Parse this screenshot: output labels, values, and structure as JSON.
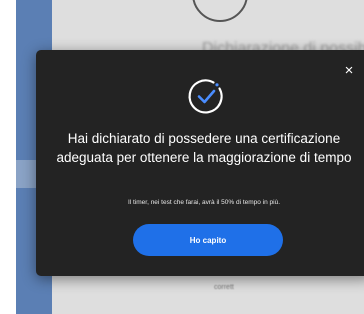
{
  "background": {
    "heading": "Dichiarazione di possibilità",
    "footer_text": "corrett"
  },
  "modal": {
    "icon": "check-circle-icon",
    "title": "Hai dichiarato di possedere una certificazione adeguata per ottenere la maggiorazione di tempo",
    "note": "Il timer, nei test che farai, avrà il 50% di tempo in più.",
    "confirm_label": "Ho capito",
    "close_glyph": "×"
  },
  "colors": {
    "modal_bg": "#232323",
    "accent": "#1f70e8",
    "check_stroke": "#4a8dff",
    "backdrop": "#dedede",
    "sidebar": "#5b7fb4"
  }
}
